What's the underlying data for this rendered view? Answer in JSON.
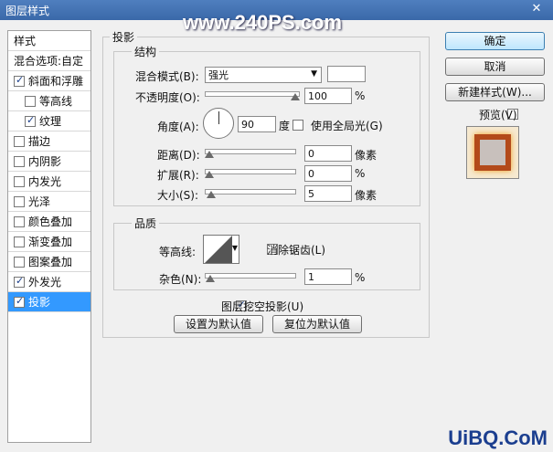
{
  "window": {
    "title": "图层样式",
    "watermark": "www.240PS.com"
  },
  "styles_list": {
    "header": "样式",
    "blend_options": "混合选项:自定",
    "items": [
      {
        "label": "斜面和浮雕",
        "checked": true,
        "indent": false
      },
      {
        "label": "等高线",
        "checked": false,
        "indent": true
      },
      {
        "label": "纹理",
        "checked": true,
        "indent": true
      },
      {
        "label": "描边",
        "checked": false,
        "indent": false
      },
      {
        "label": "内阴影",
        "checked": false,
        "indent": false
      },
      {
        "label": "内发光",
        "checked": false,
        "indent": false
      },
      {
        "label": "光泽",
        "checked": false,
        "indent": false
      },
      {
        "label": "颜色叠加",
        "checked": false,
        "indent": false
      },
      {
        "label": "渐变叠加",
        "checked": false,
        "indent": false
      },
      {
        "label": "图案叠加",
        "checked": false,
        "indent": false
      },
      {
        "label": "外发光",
        "checked": true,
        "indent": false
      },
      {
        "label": "投影",
        "checked": true,
        "indent": false,
        "selected": true
      }
    ]
  },
  "section": {
    "title": "投影",
    "structure": {
      "legend": "结构",
      "blend_mode_label": "混合模式(B):",
      "blend_mode_value": "强光",
      "opacity_label": "不透明度(O):",
      "opacity_value": "100",
      "opacity_unit": "%",
      "opacity_fraction": 1.0,
      "angle_label": "角度(A):",
      "angle_value": "90",
      "angle_unit": "度",
      "global_light_label": "使用全局光(G)",
      "global_light_checked": false,
      "distance_label": "距离(D):",
      "distance_value": "0",
      "distance_unit": "像素",
      "distance_fraction": 0.0,
      "spread_label": "扩展(R):",
      "spread_value": "0",
      "spread_unit": "%",
      "spread_fraction": 0.0,
      "size_label": "大小(S):",
      "size_value": "5",
      "size_unit": "像素",
      "size_fraction": 0.02
    },
    "quality": {
      "legend": "品质",
      "contour_label": "等高线:",
      "antialias_label": "消除锯齿(L)",
      "antialias_checked": false,
      "noise_label": "杂色(N):",
      "noise_value": "1",
      "noise_unit": "%",
      "noise_fraction": 0.01
    },
    "knockout_label": "图层挖空投影(U)",
    "knockout_checked": true,
    "make_default_label": "设置为默认值",
    "reset_default_label": "复位为默认值"
  },
  "buttons": {
    "ok": "确定",
    "cancel": "取消",
    "new_style": "新建样式(W)...",
    "preview_label": "预览(V)",
    "preview_checked": false
  },
  "site_logo": "UiBQ.CoM"
}
